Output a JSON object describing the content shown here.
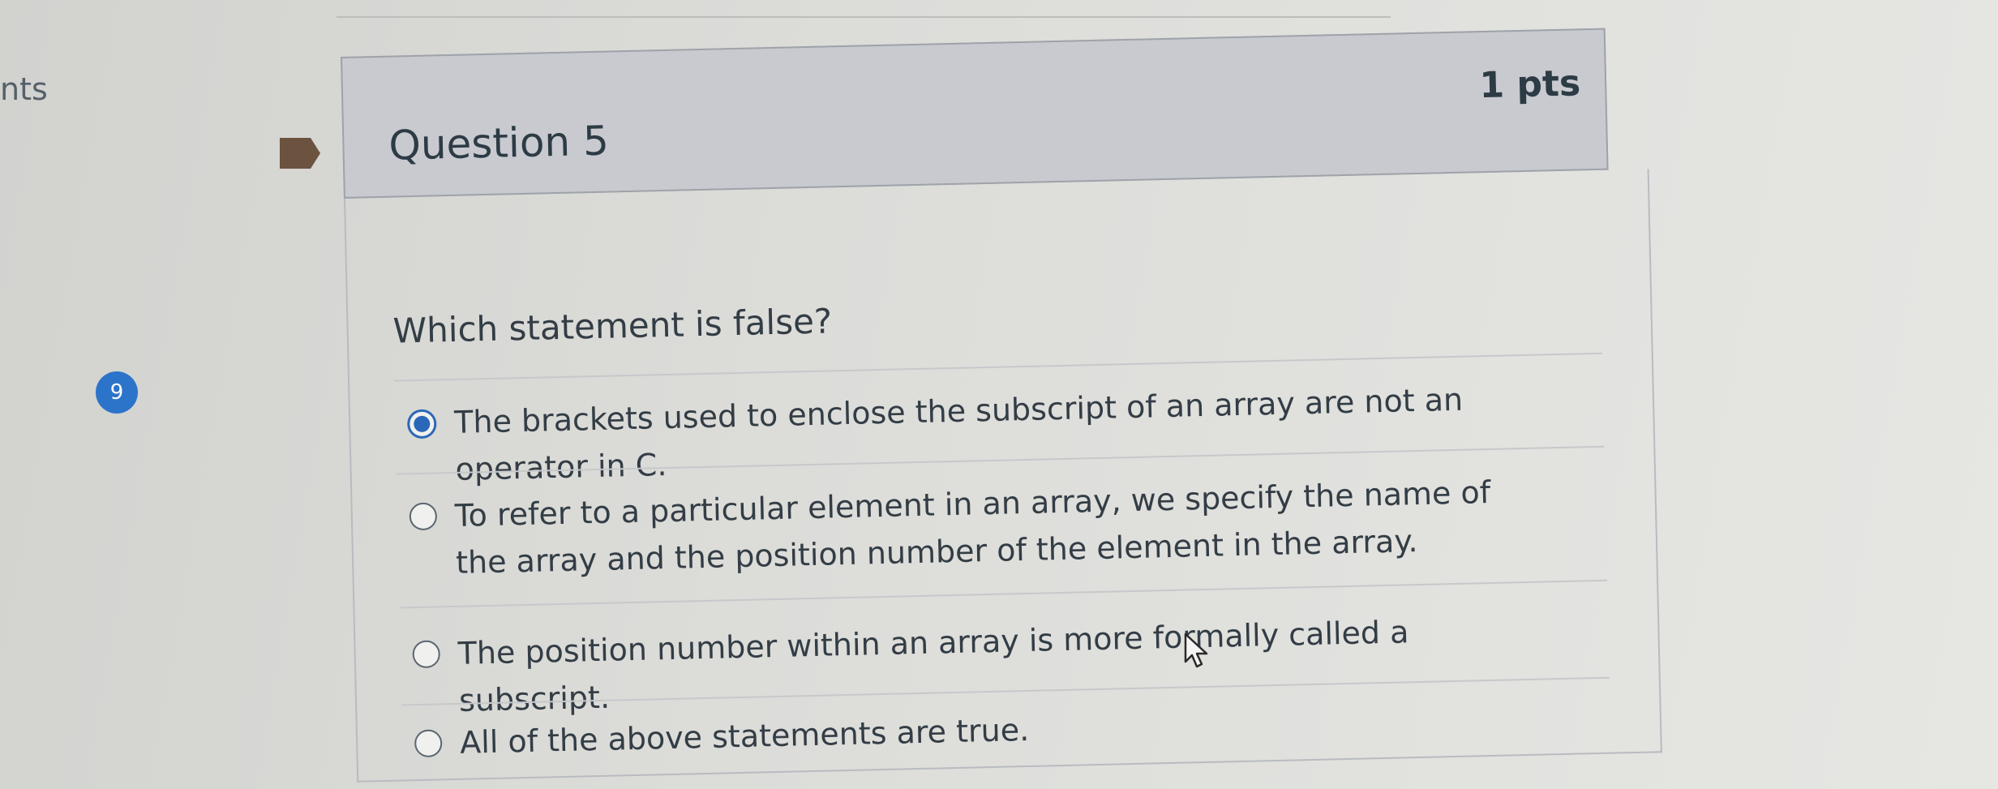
{
  "page": {
    "left_fragment": "nts"
  },
  "sidebar": {
    "question_badge": "9"
  },
  "question": {
    "title": "Question 5",
    "points": "1 pts",
    "prompt": "Which statement is false?",
    "options": [
      {
        "label": "The brackets used to enclose the subscript of an array are not an operator in C.",
        "selected": true
      },
      {
        "label": "To refer to a particular element in an array, we specify the name of the array and the position number of the element in the array.",
        "selected": false
      },
      {
        "label": "The position number within an array is more formally called a subscript.",
        "selected": false
      },
      {
        "label": "All of the above statements are true.",
        "selected": false
      }
    ]
  },
  "colors": {
    "accent": "#2b67b8",
    "badge": "#2c74c9",
    "flag": "#6b5340",
    "header_bg": "#c8cad0"
  },
  "icons": {
    "flag": "bookmark-flag-icon",
    "cursor": "mouse-pointer-icon"
  }
}
